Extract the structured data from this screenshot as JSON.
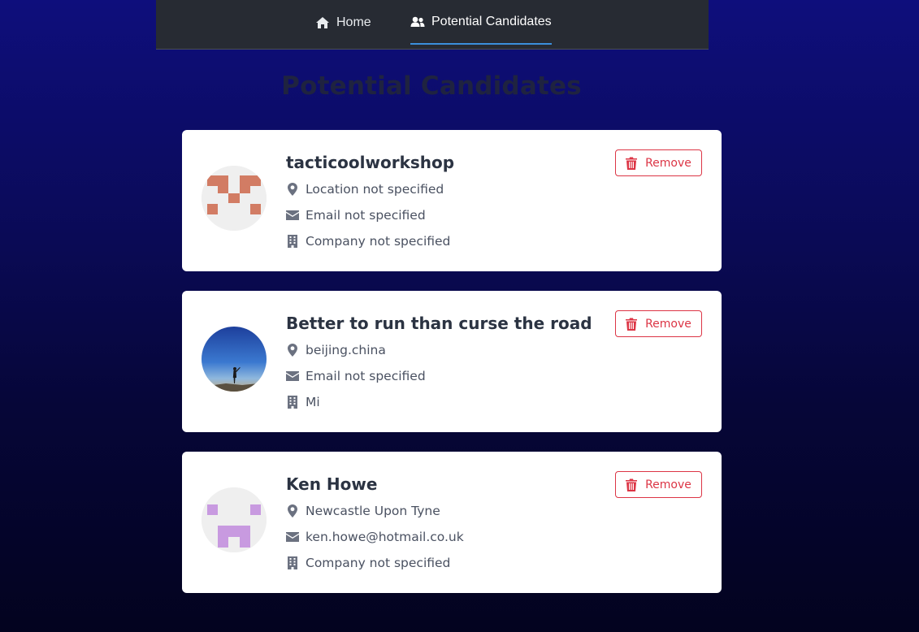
{
  "nav": {
    "home": {
      "label": "Home",
      "icon": "home-icon"
    },
    "candidates": {
      "label": "Potential Candidates",
      "icon": "users-icon",
      "active": true
    }
  },
  "page": {
    "title": "Potential Candidates"
  },
  "candidates": [
    {
      "name": "tacticoolworkshop",
      "location": "Location not specified",
      "email": "Email not specified",
      "company": "Company not specified",
      "avatar": "identicon-salmon",
      "remove_label": "Remove"
    },
    {
      "name": "Better to run than curse the road",
      "location": "beijing.china",
      "email": "Email not specified",
      "company": "Mi",
      "avatar": "photo-sky",
      "remove_label": "Remove"
    },
    {
      "name": "Ken Howe",
      "location": "Newcastle Upon Tyne",
      "email": "ken.howe@hotmail.co.uk",
      "company": "Company not specified",
      "avatar": "identicon-lavender",
      "remove_label": "Remove"
    }
  ],
  "colors": {
    "accent": "#3b8fdc",
    "danger": "#dc3545",
    "nav_bg": "#272b33",
    "identicon_salmon": "#d27c64",
    "identicon_lavender": "#c89ae0"
  }
}
